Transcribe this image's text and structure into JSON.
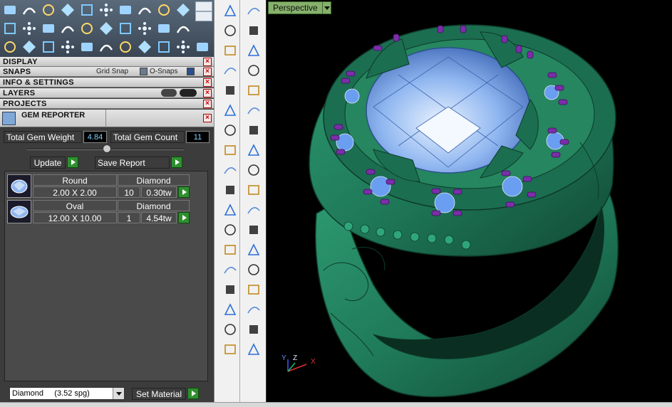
{
  "panels": {
    "display": "DISPLAY",
    "snaps": "SNAPS",
    "grid_snap": "Grid Snap",
    "o_snaps": "O-Snaps",
    "info_settings": "INFO & SETTINGS",
    "layers": "LAYERS",
    "projects": "PROJECTS",
    "gem_reporter": "GEM REPORTER"
  },
  "gem_reporter": {
    "total_weight_label": "Total Gem Weight",
    "total_weight_value": "4.84",
    "total_count_label": "Total Gem Count",
    "total_count_value": "11",
    "update_label": "Update",
    "save_report_label": "Save Report",
    "gems": [
      {
        "shape": "Round",
        "material": "Diamond",
        "size": "2.00 X 2.00",
        "count": "10",
        "weight": "0.30tw"
      },
      {
        "shape": "Oval",
        "material": "Diamond",
        "size": "12.00 X 10.00",
        "count": "1",
        "weight": "4.54tw"
      }
    ]
  },
  "material": {
    "selected": "Diamond     (3.52 spg)",
    "set_label": "Set Material"
  },
  "viewport": {
    "view_name": "Perspective",
    "axis_y": "Y",
    "axis_z": "Z",
    "axis_x": "X"
  },
  "colors": {
    "ring": "#1f7a5a",
    "gem": "#8fb6f0",
    "prongs": "#7a2ea8",
    "view_tab": "#86b06c"
  },
  "icons": {
    "top_toolbar": [
      "boolean-icon",
      "curve-icon",
      "add-point-icon",
      "add-point-2-icon",
      "grid-icon",
      "pave-icon",
      "gem-icon",
      "cutter-icon",
      "render-icon",
      "settings-icon",
      "layer-icon",
      "diamond-icon",
      "plane-icon",
      "page-icon",
      "door-icon",
      "mirror-icon",
      "blob-icon",
      "sparkle-icon",
      "gallery-icon",
      "cog-icon",
      "boxes-icon",
      "arc-icon",
      "fillet-icon",
      "split-icon",
      "move-icon",
      "scale-icon",
      "burst-icon",
      "link-icon",
      "unlink-icon",
      "scissors-icon",
      "circle-icon"
    ],
    "vertical_tools": [
      "cursor-icon",
      "point-icon",
      "polyline-icon",
      "rect-select-icon",
      "circle-icon",
      "ellipse-icon",
      "triangle-icon",
      "rectangle-icon",
      "polygon-icon",
      "curve-shape-icon",
      "cube-edit-icon",
      "bend-icon",
      "box-icon",
      "sphere-icon",
      "cylinder-icon",
      "surface-icon",
      "puzzle-icon",
      "star-icon",
      "knife-icon",
      "cut-icon",
      "atom-icon",
      "molecules-icon",
      "hook-icon",
      "spiral-icon",
      "text-icon",
      "extrude-icon",
      "array-icon",
      "transform-icon",
      "solid-box-icon",
      "comb-icon",
      "grid-array-icon",
      "pin-icon",
      "cut-prism-icon",
      "check-icon",
      "gem-stone-icon",
      "pencil-icon"
    ]
  }
}
